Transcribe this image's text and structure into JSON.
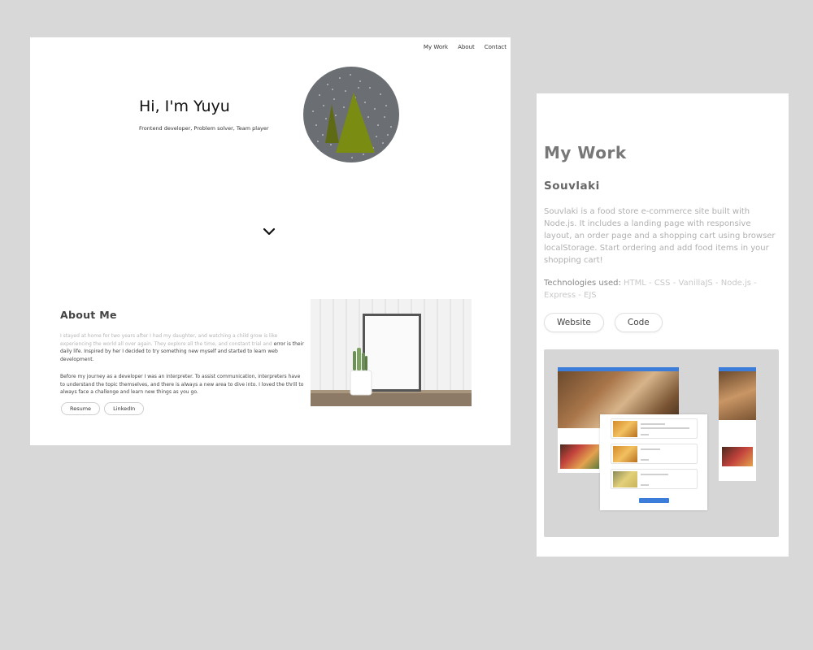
{
  "nav": {
    "items": [
      "My Work",
      "About",
      "Contact"
    ]
  },
  "hero": {
    "title": "Hi, I'm Yuyu",
    "subtitle": "Frontend developer, Problem solver, Team player"
  },
  "about": {
    "title": "About Me",
    "p1_faded": "I stayed at home for two years after I had my daughter, and watching a child grow is like experiencing the world all over again. They explore all the time, and constant trial and",
    "p1_dark": "error is their daily life. Inspired by her I decided to try something new myself and started to learn web development.",
    "p2": "Before my journey as a developer I was an interpreter. To assist communication, interpreters have to understand the topic themselves, and there is always a new area to dive into. I loved the thrill to always face a challenge and learn new things as you go.",
    "buttons": [
      "Resume",
      "LinkedIn"
    ]
  },
  "work": {
    "title": "My Work",
    "project": {
      "name": "Souvlaki",
      "description": "Souvlaki is a food store e-commerce site built with Node.js. It includes a landing page with responsive layout, an order page and a shopping cart using browser localStorage. Start ordering and add food items in your shopping cart!",
      "tech_label": "Technologies used:",
      "tech_list": "HTML - CSS - VanillaJS - Node.js - Express - EJS",
      "buttons": [
        "Website",
        "Code"
      ]
    }
  },
  "icons": {
    "chevron": "chevron-down-icon"
  },
  "colors": {
    "circle_bg": "#6b6f73",
    "tree": "#7a8c12",
    "tree_dark": "#5f6b14",
    "preview_bg": "#d6d6d6",
    "accent_blue": "#3b7dd8"
  }
}
